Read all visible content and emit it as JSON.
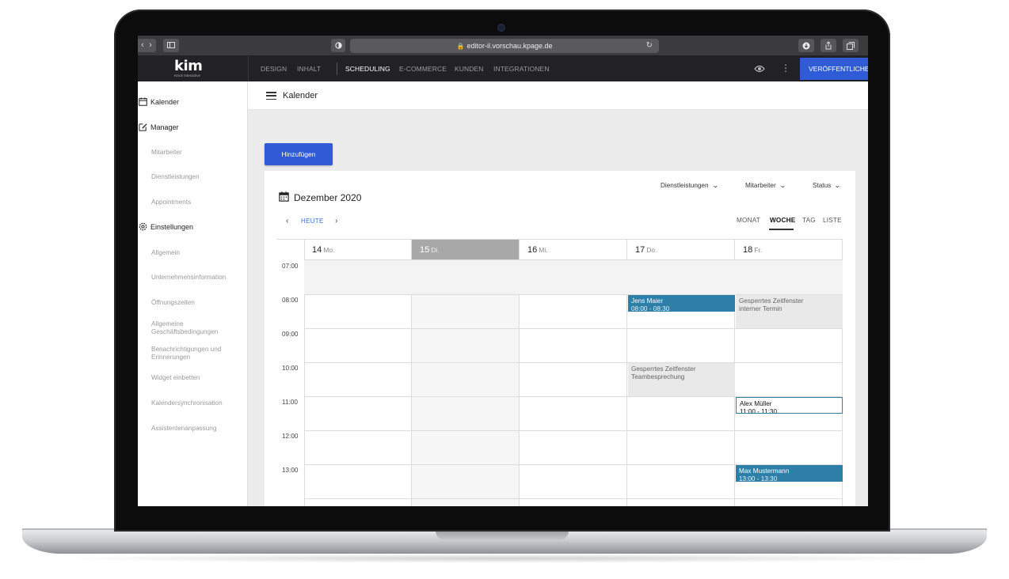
{
  "browser": {
    "url": "editor-il.vorschau.kpage.de"
  },
  "app": {
    "logo": "kim",
    "logo_sub": "Knick Interactive",
    "nav": [
      "DESIGN",
      "INHALT",
      "SCHEDULING",
      "E-COMMERCE",
      "KUNDEN",
      "INTEGRATIONEN"
    ],
    "nav_active": "SCHEDULING",
    "publish_label": "VERÖFFENTLICHEN"
  },
  "sidebar": {
    "calendar_label": "Kalender",
    "manager_label": "Manager",
    "manager_items": [
      "Mitarbeiter",
      "Dienstleistungen",
      "Appointments"
    ],
    "settings_label": "Einstellungen",
    "settings_items": [
      "Allgemein",
      "Unternehmensinformation",
      "Öffnungszeiten",
      "Allgemeine Geschäftsbedingungen",
      "Benachrichtigungen und Erinnerungen",
      "Widget einbetten",
      "Kalendersynchronisation",
      "Assistentenanpassung"
    ]
  },
  "page": {
    "title": "Kalender",
    "add_button": "Hinzufügen"
  },
  "calendar": {
    "month": "Dezember 2020",
    "today_label": "HEUTE",
    "filters": [
      "Dienstleistungen",
      "Mitarbeiter",
      "Status"
    ],
    "views": [
      "MONAT",
      "WOCHE",
      "TAG",
      "LISTE"
    ],
    "active_view": "WOCHE",
    "days": [
      {
        "num": "14",
        "wd": "Mo."
      },
      {
        "num": "15",
        "wd": "Di."
      },
      {
        "num": "16",
        "wd": "Mi."
      },
      {
        "num": "17",
        "wd": "Do."
      },
      {
        "num": "18",
        "wd": "Fr."
      }
    ],
    "today_day": "15",
    "hours": [
      "07:00",
      "08:00",
      "09:00",
      "10:00",
      "11:00",
      "12:00",
      "13:00"
    ],
    "events": [
      {
        "day": 3,
        "start": 8.0,
        "end": 8.5,
        "kind": "booked",
        "title": "Jens Maier",
        "time": "08:00 - 08:30"
      },
      {
        "day": 4,
        "start": 8.0,
        "end": 9.0,
        "kind": "blocked",
        "title": "Gesperrtes Zeitfenster",
        "time": "interner Termin"
      },
      {
        "day": 3,
        "start": 10.0,
        "end": 11.0,
        "kind": "blocked",
        "title": "Gesperrtes Zeitfenster",
        "time": "Teambesprechung"
      },
      {
        "day": 4,
        "start": 11.0,
        "end": 11.5,
        "kind": "outlined",
        "title": "Alex Müller",
        "time": "11:00 - 11:30"
      },
      {
        "day": 4,
        "start": 13.0,
        "end": 13.5,
        "kind": "booked",
        "title": "Max Mustermann",
        "time": "13:00 - 13:30"
      }
    ]
  },
  "colors": {
    "primary": "#2f5bd6",
    "booked": "#2d7fa8",
    "blocked": "#e9e9e9",
    "nav_bg": "#222224"
  }
}
